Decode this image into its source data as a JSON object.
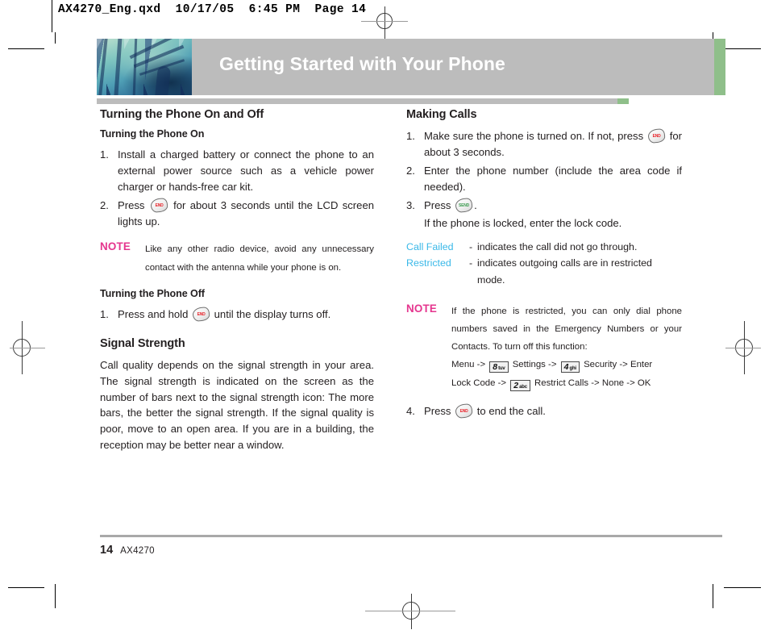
{
  "prepress": {
    "strip": "AX4270_Eng.qxd  10/17/05  6:45 PM  Page 14"
  },
  "banner": {
    "title": "Getting Started with Your Phone",
    "accent_color": "#8fbf8a",
    "bar_color": "#bcbcbc",
    "photo_alt": "abstract-architecture-photo"
  },
  "left_column": {
    "section_title": "Turning the Phone On and Off",
    "sub_on": "Turning the Phone On",
    "steps_on": [
      {
        "num": "1.",
        "text": "Install a charged battery or connect the phone to an external power source such as a vehicle power charger or hands-free car kit."
      },
      {
        "num": "2.",
        "pre": "Press",
        "key": "END",
        "post": "for about 3 seconds until the LCD screen lights up."
      }
    ],
    "note1": {
      "label": "NOTE",
      "text": "Like any other radio device, avoid any unnecessary contact with the antenna while your phone is on."
    },
    "sub_off": "Turning the Phone Off",
    "step_off": {
      "num": "1.",
      "pre": "Press and hold",
      "key": "END",
      "post": "until the display turns off."
    },
    "signal_title": "Signal Strength",
    "signal_text": "Call quality depends on the signal strength in your area. The signal strength is indicated on the screen as the number of bars next to the signal strength icon: The more bars, the better the signal strength. If the signal quality is poor, move to an open area. If you are in a building, the reception may be better near a window."
  },
  "right_column": {
    "section_title": "Making Calls",
    "steps": [
      {
        "num": "1.",
        "pre": "Make sure the phone is turned on. If not, press",
        "key": "END",
        "post": "for about 3 seconds."
      },
      {
        "num": "2.",
        "text": "Enter the phone number (include the area code if needed)."
      },
      {
        "num": "3.",
        "pre": "Press",
        "key": "SEND",
        "post": ".",
        "extra": "If the phone is locked, enter the lock code."
      }
    ],
    "terms": [
      {
        "name": "Call Failed",
        "dash": "-",
        "definition": "indicates the call did not go through.",
        "continuation": ""
      },
      {
        "name": "Restricted",
        "dash": "-",
        "definition": "indicates outgoing calls are in restricted",
        "continuation": "mode."
      }
    ],
    "term_color": "#39b8e8",
    "note2": {
      "label": "NOTE",
      "text": "If the phone is restricted, you can only dial phone numbers saved in the Emergency Numbers or your Contacts. To turn off this function:",
      "path_line1_a": "Menu ->",
      "key8": {
        "digit": "8",
        "letters": "tuv"
      },
      "path_line1_b": "Settings ->",
      "key4": {
        "digit": "4",
        "letters": "ghi"
      },
      "path_line1_c": "Security -> Enter",
      "path_line2_a": "Lock Code ->",
      "key2": {
        "digit": "2",
        "letters": "abc"
      },
      "path_line2_b": "Restrict Calls -> None -> OK"
    },
    "step4": {
      "num": "4.",
      "pre": "Press",
      "key": "END",
      "post": "to end the call."
    }
  },
  "footer": {
    "page_number": "14",
    "book": "AX4270"
  },
  "note_label_color": "#e5358e"
}
